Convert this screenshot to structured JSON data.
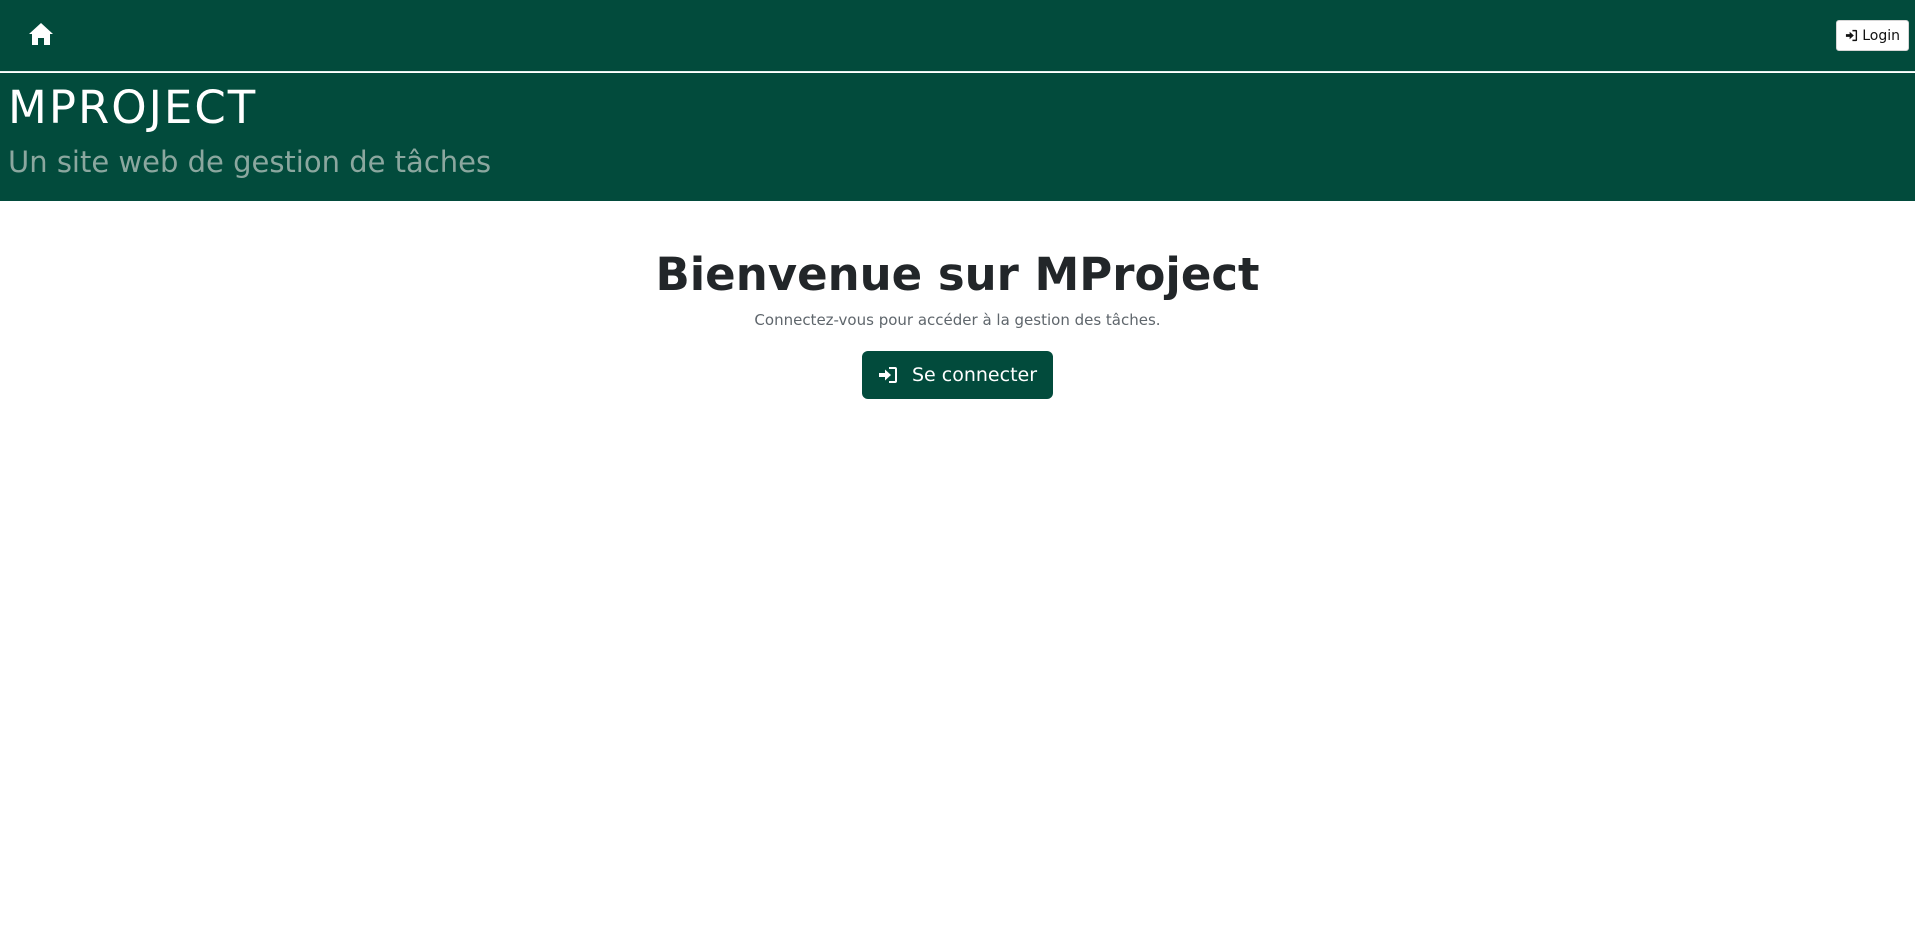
{
  "navbar": {
    "home_icon": "home-icon",
    "login_label": "Login",
    "login_icon": "sign-in-icon"
  },
  "hero": {
    "title": "MPROJECT",
    "tagline": "Un site web de gestion de tâches"
  },
  "main": {
    "heading": "Bienvenue sur MProject",
    "subtitle": "Connectez-vous pour accéder à la gestion des tâches.",
    "connect_label": "Se connecter",
    "connect_icon": "sign-in-icon"
  },
  "colors": {
    "brand": "#024b3c",
    "tagline": "#8ba79f",
    "heading": "#222629",
    "muted": "#5f666c"
  }
}
